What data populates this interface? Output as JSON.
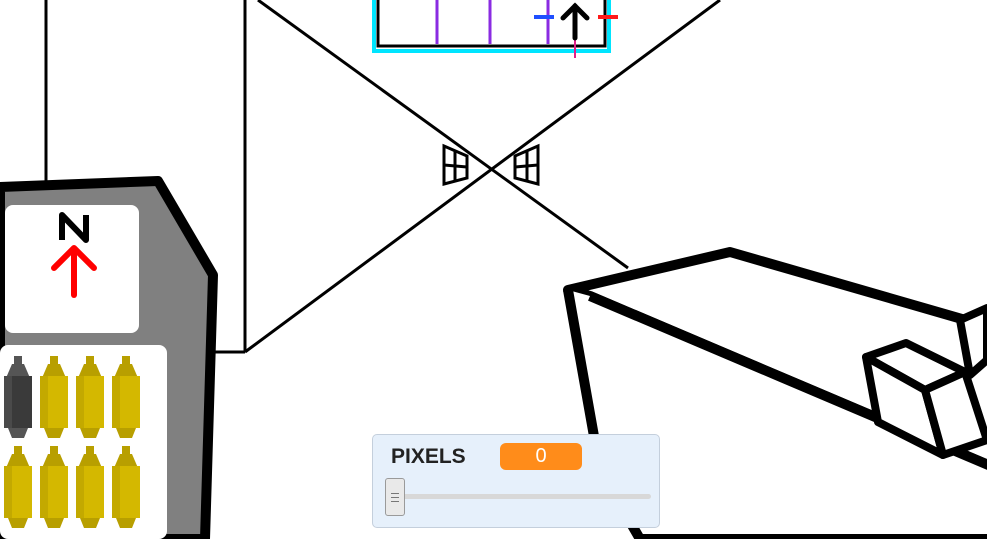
{
  "hud": {
    "compass": {
      "letter": "N",
      "arrow_color": "#ff0000"
    },
    "items": [
      {
        "type": "battery",
        "state": "empty",
        "color": "#3a3a3a"
      },
      {
        "type": "battery",
        "state": "full",
        "color": "#d4b800"
      },
      {
        "type": "battery",
        "state": "full",
        "color": "#d4b800"
      },
      {
        "type": "battery",
        "state": "full",
        "color": "#d4b800"
      },
      {
        "type": "battery",
        "state": "full",
        "color": "#d4b800"
      },
      {
        "type": "battery",
        "state": "full",
        "color": "#d4b800"
      },
      {
        "type": "battery",
        "state": "full",
        "color": "#d4b800"
      },
      {
        "type": "battery",
        "state": "full",
        "color": "#d4b800"
      }
    ]
  },
  "monitor": {
    "label": "PIXELS",
    "value": "0",
    "value_color": "#ff8c1a",
    "slider_fraction": 0
  }
}
